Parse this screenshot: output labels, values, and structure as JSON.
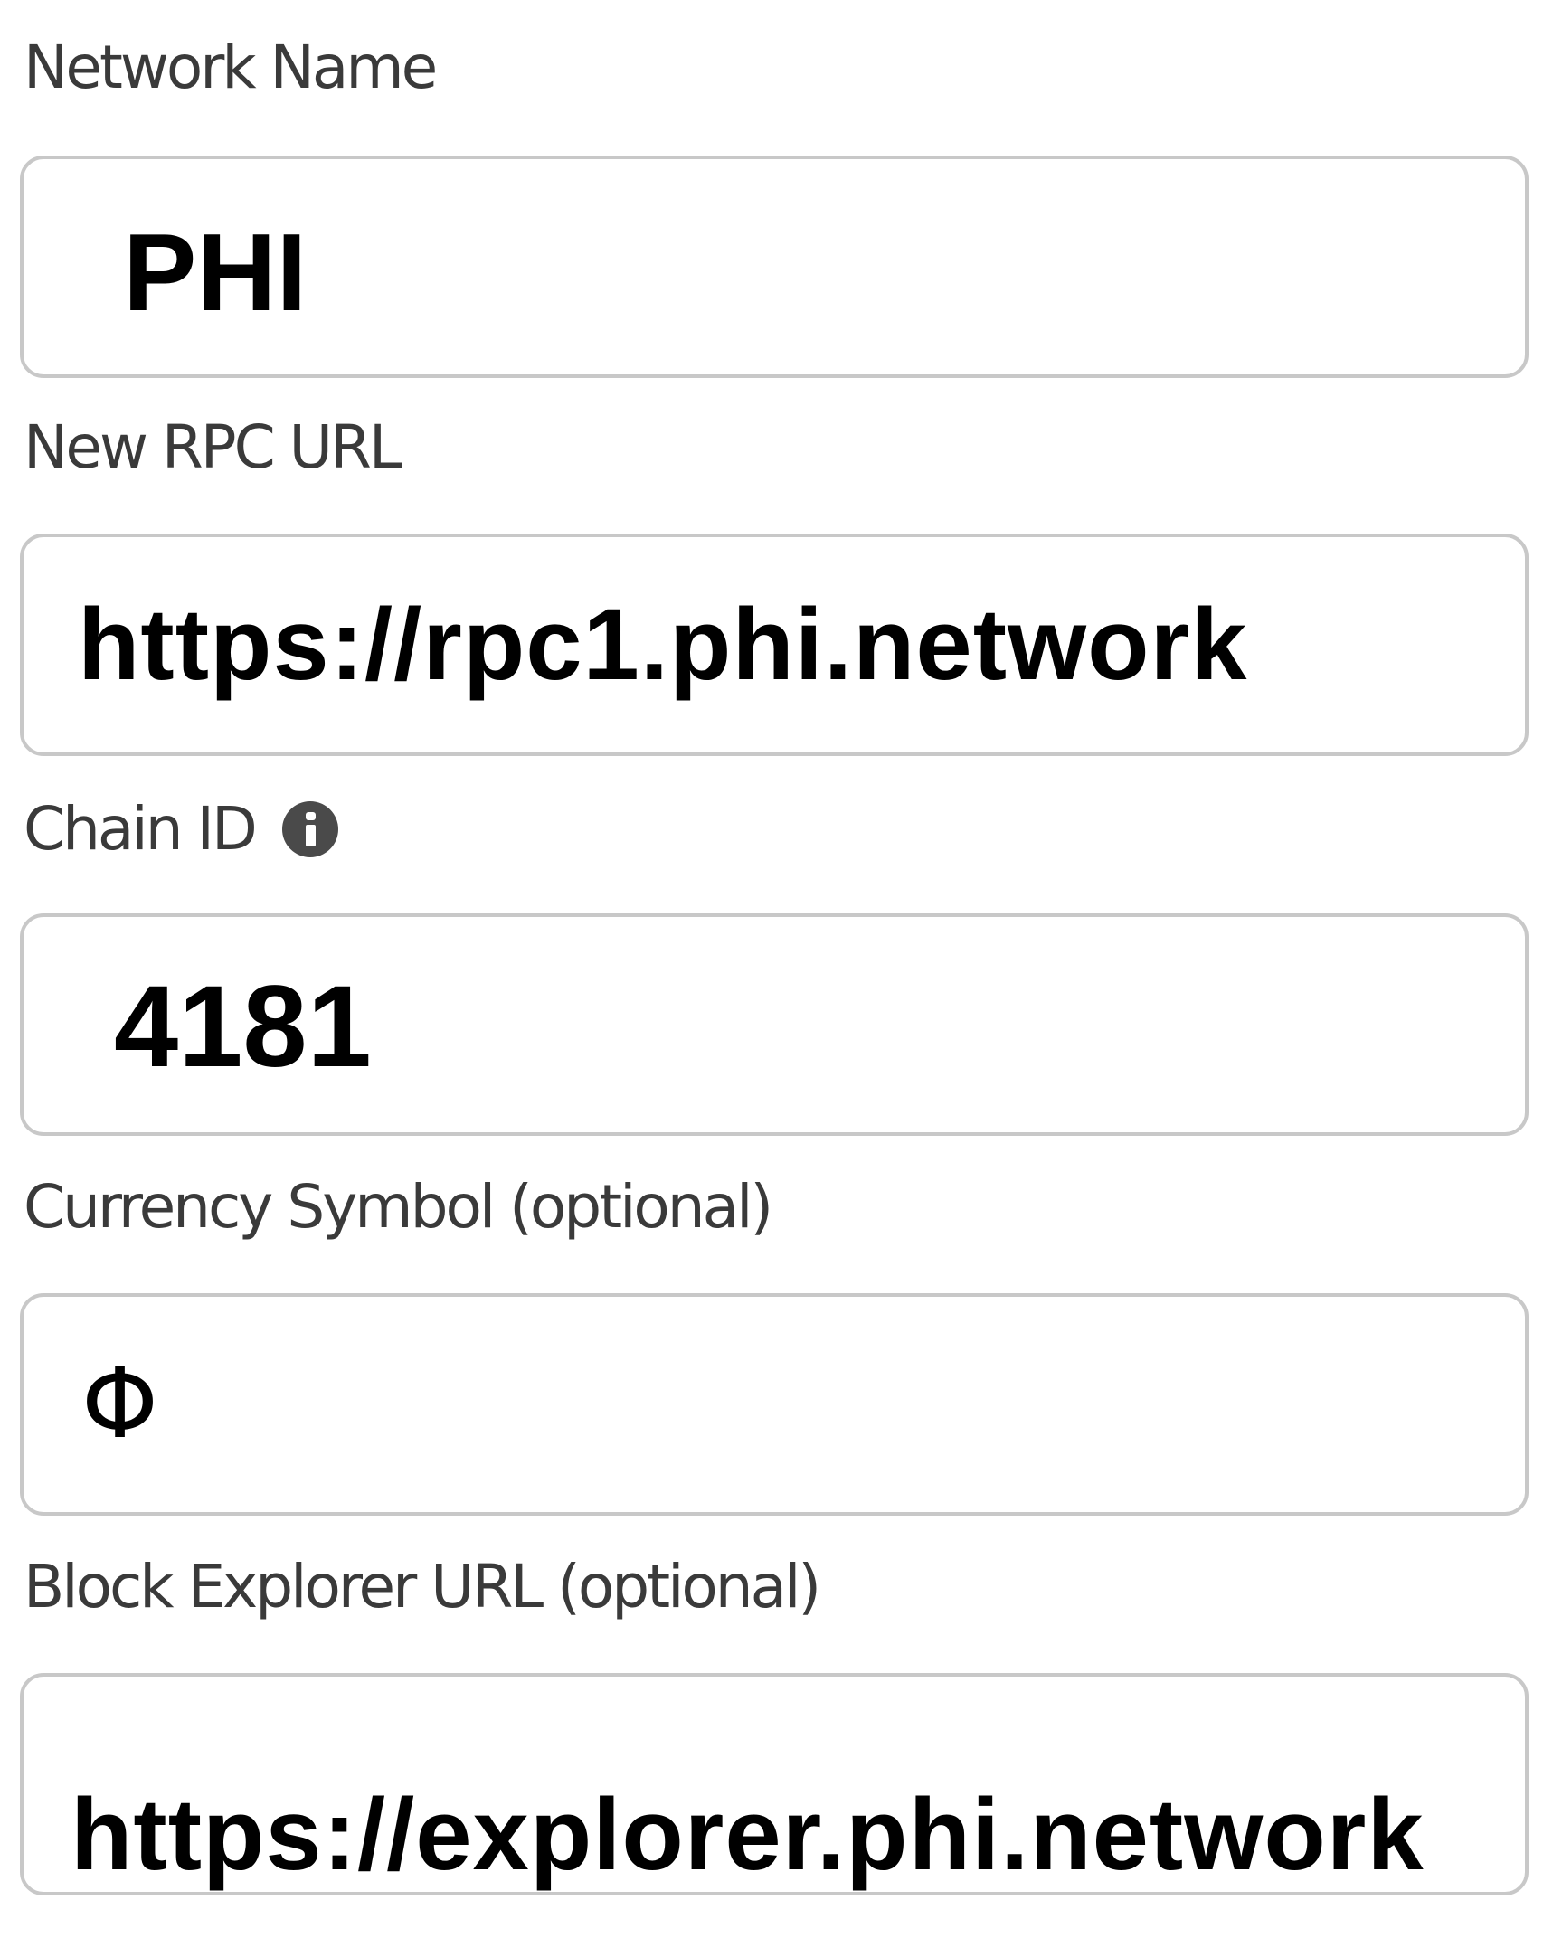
{
  "form": {
    "network_name": {
      "label": "Network Name",
      "value": "PHI"
    },
    "rpc_url": {
      "label": "New RPC URL",
      "value": "https://rpc1.phi.network"
    },
    "chain_id": {
      "label": "Chain ID",
      "value": "4181",
      "info_icon": "info-icon"
    },
    "currency_symbol": {
      "label": "Currency Symbol (optional)",
      "value": "Φ"
    },
    "block_explorer_url": {
      "label": "Block Explorer URL (optional)",
      "value": "https://explorer.phi.network"
    }
  },
  "colors": {
    "label_text": "#3a3a3a",
    "field_border": "#c8c8c8",
    "value_text": "#000000",
    "info_icon": "#4a4a4a"
  }
}
